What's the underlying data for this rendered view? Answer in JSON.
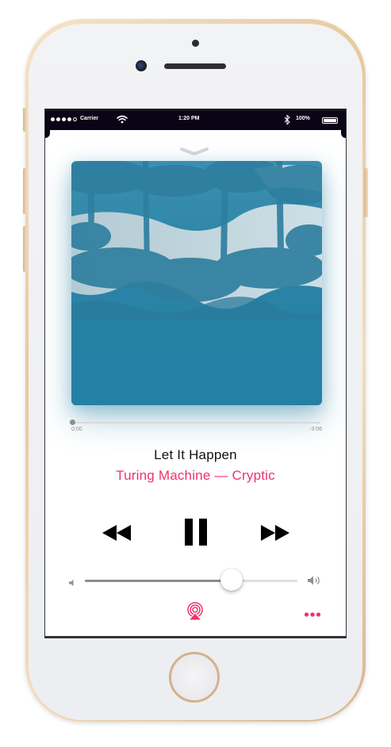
{
  "status_bar": {
    "carrier": "Carrier",
    "time": "1:20 PM",
    "battery": "100%",
    "signal_bars_filled": 4,
    "signal_bars_total": 5
  },
  "now_playing": {
    "title": "Let It Happen",
    "artist_album": "Turing Machine — Cryptic",
    "elapsed": "0:00",
    "remaining": "-3:06",
    "progress_fraction": 0.0,
    "volume_fraction": 0.69
  },
  "icons": {
    "grabber": "chevron-down-icon",
    "rewind": "rewind-icon",
    "pause": "pause-icon",
    "forward": "fast-forward-icon",
    "volume_low": "speaker-low-icon",
    "volume_high": "speaker-high-icon",
    "airplay": "airplay-icon",
    "more": "more-icon"
  },
  "colors": {
    "accent": "#f0316a",
    "status_bar": "#0a0416",
    "album_primary": "#2f8aa8"
  }
}
